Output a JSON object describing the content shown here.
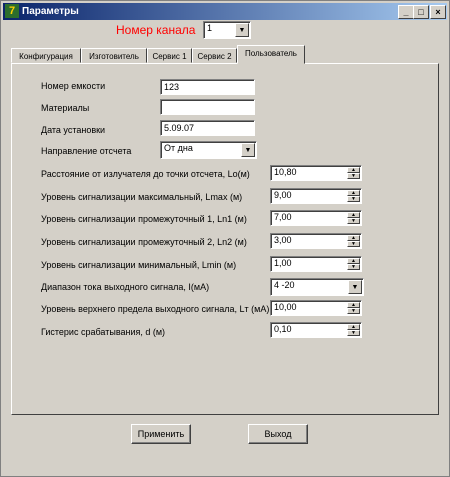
{
  "window": {
    "title": "Параметры",
    "icon": "app-logo-icon",
    "controls": {
      "minimize": "_",
      "maximize": "□",
      "close": "×"
    }
  },
  "channel": {
    "label": "Номер канала",
    "value": "1"
  },
  "tabs": [
    {
      "label": "Конфигурация",
      "active": false
    },
    {
      "label": "Изготовитель",
      "active": false
    },
    {
      "label": "Сервис 1",
      "active": false
    },
    {
      "label": "Сервис 2",
      "active": false
    },
    {
      "label": "Пользователь",
      "active": true
    }
  ],
  "fields": {
    "tank_number": {
      "label": "Номер емкости",
      "value": "123"
    },
    "materials": {
      "label": "Материалы",
      "value": ""
    },
    "install_date": {
      "label": "Дата установки",
      "value": "5.09.07"
    },
    "direction": {
      "label": "Направление отсчета",
      "value": "От дна"
    }
  },
  "params": [
    {
      "label": "Расстояние от излучателя до точки отсчета, Lo(м)",
      "value": "10,80",
      "control": "spin"
    },
    {
      "label": "Уровень сигнализации максимальный, Lmax (м)",
      "value": "9,00",
      "control": "spin"
    },
    {
      "label": "Уровень сигнализации промежуточный 1, Ln1 (м)",
      "value": "7,00",
      "control": "spin"
    },
    {
      "label": "Уровень сигнализации промежуточный 2, Ln2 (м)",
      "value": "3,00",
      "control": "spin"
    },
    {
      "label": "Уровень сигнализации минимальный, Lmin (м)",
      "value": "1,00",
      "control": "spin"
    },
    {
      "label": "Диапазон тока выходного сигнала, I(мА)",
      "value": "4 -20",
      "control": "combo"
    },
    {
      "label": "Уровень верхнего предела выходного сигнала, Lт (мА)",
      "value": "10,00",
      "control": "spin"
    },
    {
      "label": "Гистерис срабатывания, d (м)",
      "value": "0,10",
      "control": "spin"
    }
  ],
  "buttons": {
    "apply": "Применить",
    "exit": "Выход"
  },
  "colors": {
    "titlebar_start": "#0a246a",
    "titlebar_end": "#a6caf0",
    "channel_label": "#ff0000",
    "face": "#d4d0c8"
  }
}
